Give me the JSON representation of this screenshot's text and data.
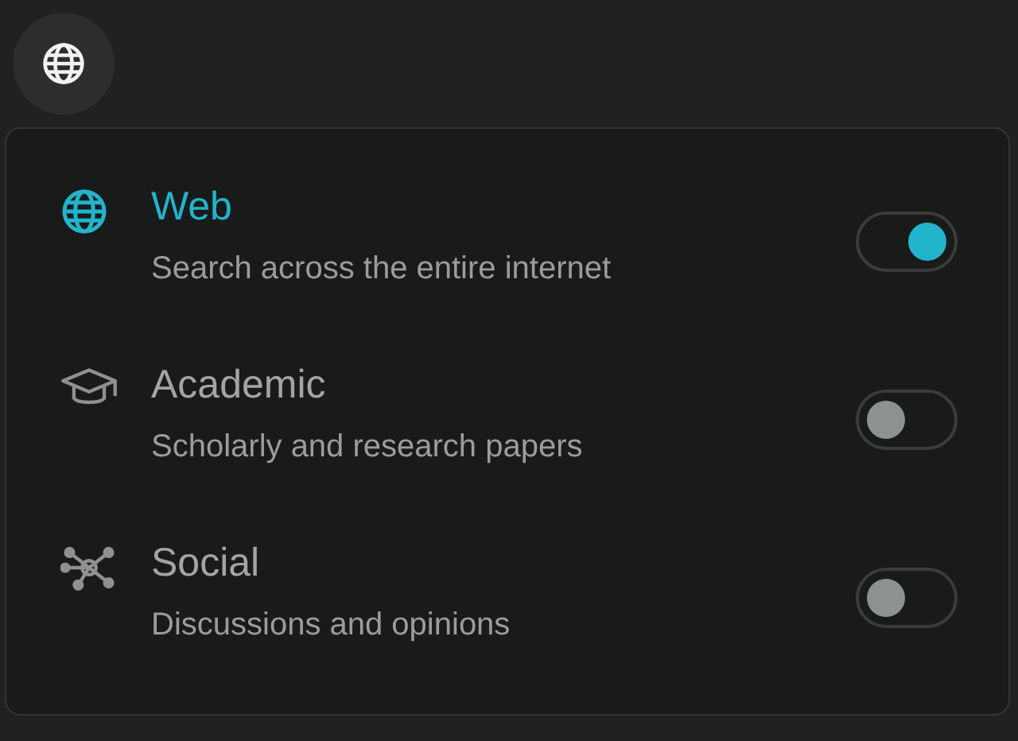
{
  "sources": [
    {
      "kind": "web",
      "title": "Web",
      "description": "Search across the entire internet",
      "on": true
    },
    {
      "kind": "academic",
      "title": "Academic",
      "description": "Scholarly and research papers",
      "on": false
    },
    {
      "kind": "social",
      "title": "Social",
      "description": "Discussions and opinions",
      "on": false
    }
  ]
}
